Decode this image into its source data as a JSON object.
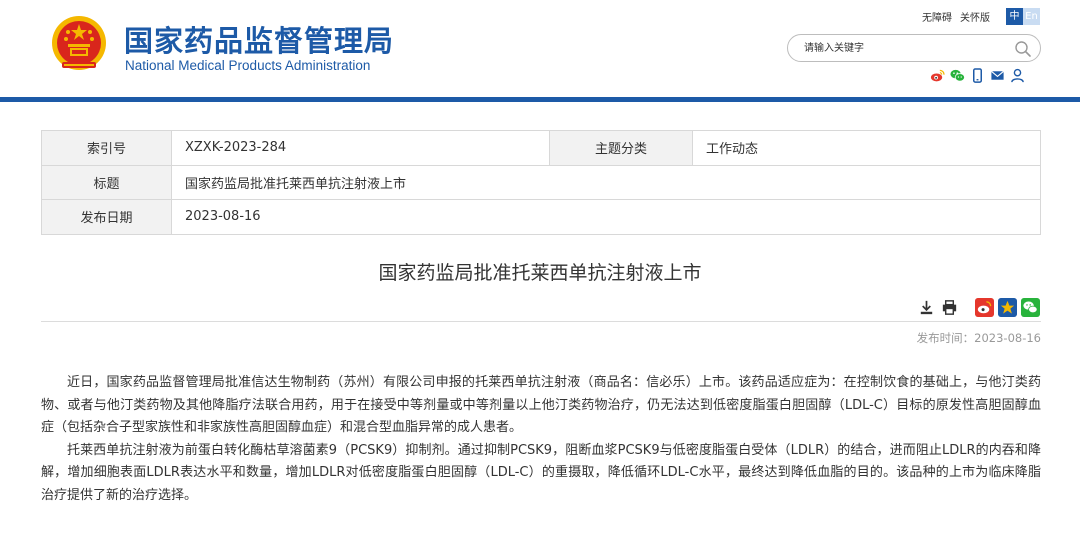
{
  "header": {
    "org_name_cn": "国家药品监督管理局",
    "org_name_en": "National Medical Products Administration",
    "accessibility_link": "无障碍",
    "elderly_link": "关怀版",
    "lang_zh": "中",
    "lang_en": "En",
    "search_placeholder": "请输入关键字"
  },
  "colors": {
    "brand_blue": "#1d5aa7",
    "weibo_red": "#e5372c",
    "wechat_green": "#28b33c",
    "favorite_yellow": "#f5b800"
  },
  "icons": {
    "header_share": [
      "weibo-icon",
      "wechat-icon",
      "mobile-icon",
      "mail-icon",
      "user-icon"
    ],
    "article_tools": [
      "download-icon",
      "print-icon",
      "weibo-icon",
      "favorite-icon",
      "wechat-icon"
    ]
  },
  "info": {
    "index_label": "索引号",
    "index_value": "XZXK-2023-284",
    "category_label": "主题分类",
    "category_value": "工作动态",
    "title_label": "标题",
    "title_value": "国家药监局批准托莱西单抗注射液上市",
    "date_label": "发布日期",
    "date_value": "2023-08-16"
  },
  "article": {
    "title": "国家药监局批准托莱西单抗注射液上市",
    "publish_time": "发布时间：2023-08-16",
    "paragraphs": [
      "近日，国家药品监督管理局批准信达生物制药（苏州）有限公司申报的托莱西单抗注射液（商品名：信必乐）上市。该药品适应症为：在控制饮食的基础上，与他汀类药物、或者与他汀类药物及其他降脂疗法联合用药，用于在接受中等剂量或中等剂量以上他汀类药物治疗，仍无法达到低密度脂蛋白胆固醇（LDL-C）目标的原发性高胆固醇血症（包括杂合子型家族性和非家族性高胆固醇血症）和混合型血脂异常的成人患者。",
      "托莱西单抗注射液为前蛋白转化酶枯草溶菌素9（PCSK9）抑制剂。通过抑制PCSK9，阻断血浆PCSK9与低密度脂蛋白受体（LDLR）的结合，进而阻止LDLR的内吞和降解，增加细胞表面LDLR表达水平和数量，增加LDLR对低密度脂蛋白胆固醇（LDL-C）的重摄取，降低循环LDL-C水平，最终达到降低血脂的目的。该品种的上市为临床降脂治疗提供了新的治疗选择。"
    ]
  }
}
